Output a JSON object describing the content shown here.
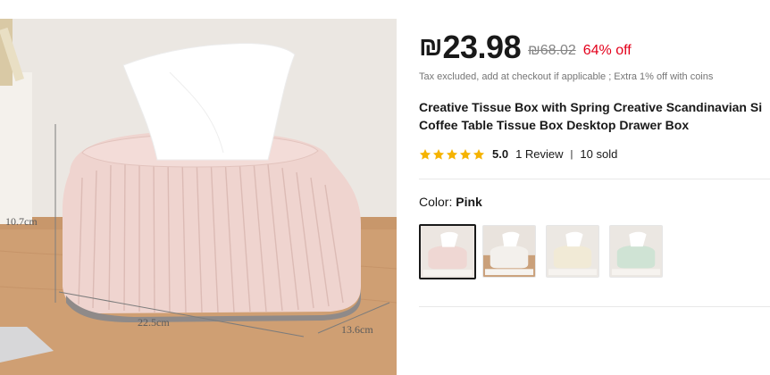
{
  "product_image": {
    "alt_name": "product-photo",
    "dimensions": {
      "height": "10.7cm",
      "width": "22.5cm",
      "depth": "13.6cm"
    }
  },
  "price": {
    "currency_symbol": "₪",
    "current": "23.98",
    "original": "₪68.02",
    "discount": "64% off"
  },
  "tax_note": "Tax excluded, add at checkout if applicable ; Extra 1% off with coins",
  "title": {
    "line1": "Creative Tissue Box with Spring Creative Scandinavian Si",
    "line2": "Coffee Table Tissue Box Desktop Drawer Box"
  },
  "rating": {
    "stars": 5,
    "value": "5.0",
    "reviews": "1 Review",
    "separator": "|",
    "sold": "10 sold"
  },
  "color": {
    "label": "Color: ",
    "selected": "Pink",
    "options": [
      {
        "name": "pink",
        "color": "#efd7d3",
        "selected": true
      },
      {
        "name": "white",
        "color": "#f3f0ec",
        "selected": false
      },
      {
        "name": "cream",
        "color": "#f1ead6",
        "selected": false
      },
      {
        "name": "mint",
        "color": "#cfe3d4",
        "selected": false
      }
    ]
  },
  "colors": {
    "price_text": "#191919",
    "discount": "#e3001b",
    "star": "#f5b301"
  }
}
